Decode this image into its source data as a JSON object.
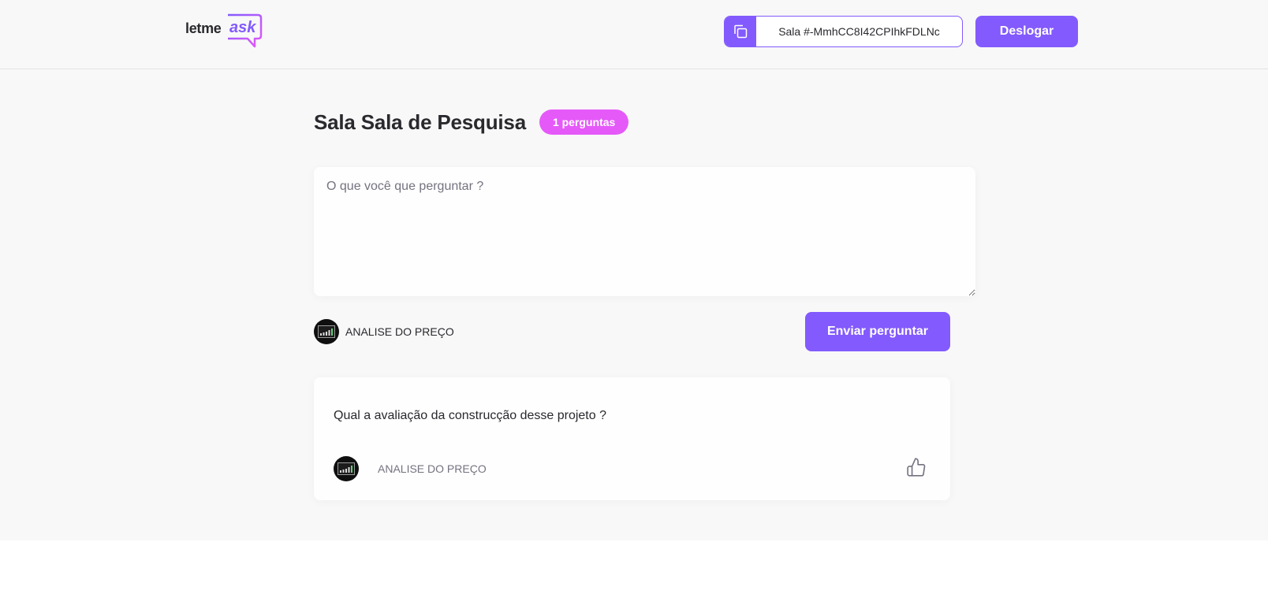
{
  "header": {
    "logo": {
      "word1": "letme",
      "word2": "ask"
    },
    "room_code_label": "Sala #-MmhCC8I42CPIhkFDLNc",
    "logout_label": "Deslogar"
  },
  "main": {
    "title": "Sala Sala de Pesquisa",
    "question_count": "1 perguntas",
    "input_placeholder": "O que você que perguntar ?",
    "user_name": "ANALISE DO PREÇO",
    "send_label": "Enviar perguntar"
  },
  "questions": [
    {
      "content": "Qual a avaliação da construcção desse projeto ?",
      "author": "ANALISE DO PREÇO"
    }
  ],
  "colors": {
    "primary": "#835afd",
    "badge": "#e559f9",
    "background": "#f8f8f8",
    "text": "#29292e",
    "muted": "#737380"
  },
  "icons": [
    "copy-icon",
    "like-icon",
    "avatar-image"
  ]
}
